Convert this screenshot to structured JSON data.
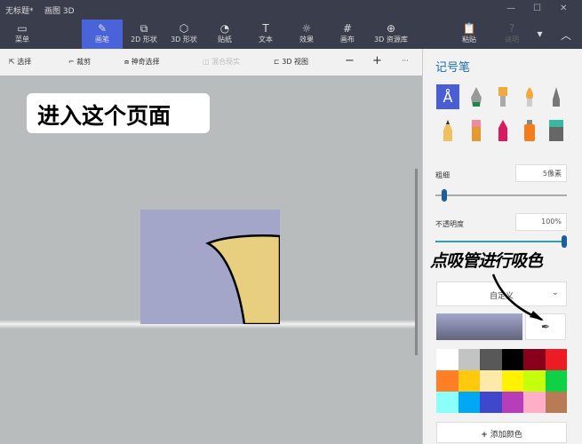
{
  "window": {
    "doc_title": "无标题*",
    "app_title": "画图 3D",
    "minimize": "—",
    "maximize": "☐",
    "close": "✕"
  },
  "ribbon": {
    "menu": "菜单",
    "items": [
      {
        "label": "画笔",
        "icon": "brush-icon"
      },
      {
        "label": "2D 形状",
        "icon": "2d-shapes-icon"
      },
      {
        "label": "3D 形状",
        "icon": "3d-shapes-icon"
      },
      {
        "label": "贴纸",
        "icon": "sticker-icon"
      },
      {
        "label": "文本",
        "icon": "text-icon"
      },
      {
        "label": "效果",
        "icon": "effects-icon"
      },
      {
        "label": "画布",
        "icon": "canvas-icon"
      },
      {
        "label": "3D 资源库",
        "icon": "3d-library-icon"
      }
    ],
    "paste": "粘贴",
    "help": "说明"
  },
  "toolbar": {
    "select": "选择",
    "crop": "裁剪",
    "magic_select": "神奇选择",
    "mixed_reality": "混合现实",
    "view3d": "3D 视图",
    "zoom_out": "−",
    "zoom_in": "+",
    "more": "···"
  },
  "canvas": {
    "label": "进入这个页面",
    "annotation": "点吸管进行吸色"
  },
  "panel": {
    "title": "记号笔",
    "thickness_label": "粗细",
    "thickness_value": "5像素",
    "thickness_pct": 5,
    "opacity_label": "不透明度",
    "opacity_value": "100%",
    "opacity_pct": 100,
    "color_mode": "自定义",
    "add_color": "添加颜色",
    "add_icon": "+",
    "palette": [
      "#ffffff",
      "#c3c3c3",
      "#585858",
      "#000000",
      "#88001b",
      "#ec1c24",
      "#ff7f27",
      "#ffc90e",
      "#fde9a8",
      "#fff200",
      "#c4ff0e",
      "#0ed145",
      "#8cfffb",
      "#00a8f3",
      "#3f48cc",
      "#b83dba",
      "#ffaec8",
      "#b97a56"
    ],
    "current_color": "#a4a6cc"
  }
}
